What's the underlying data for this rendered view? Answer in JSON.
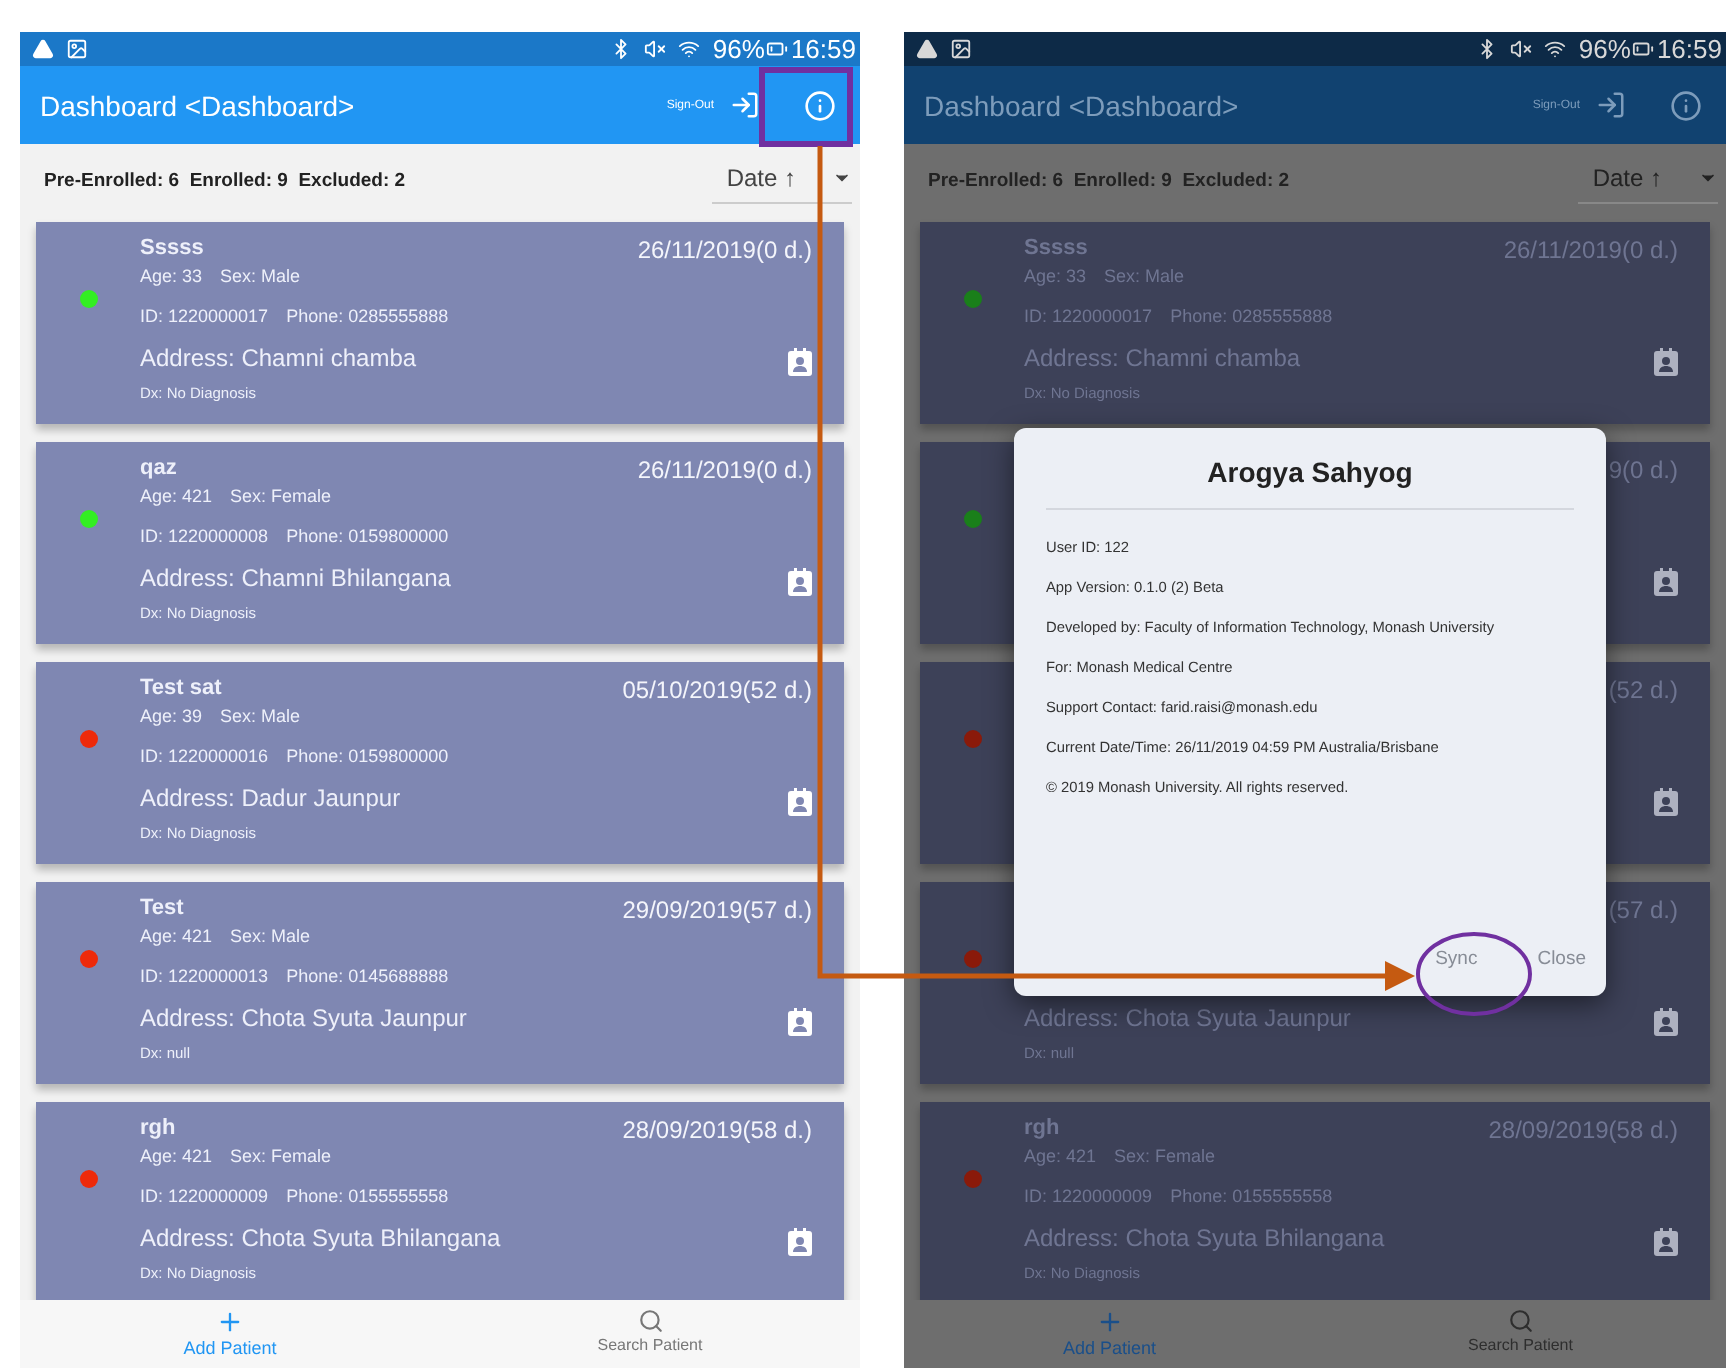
{
  "screens": [
    {
      "dimmed": false,
      "status_bar": {
        "battery": "96%",
        "time": "16:59"
      },
      "app_bar": {
        "title": "Dashboard <Dashboard>",
        "sign_out": "Sign-Out"
      },
      "summary": "Pre-Enrolled: 6  Enrolled: 9  Excluded: 2",
      "sort": {
        "label": "Date ↑"
      },
      "patients": [
        {
          "name": "Sssss",
          "age": "Age: 33",
          "sex": "Sex: Male",
          "id": "ID: 1220000017",
          "phone": "Phone: 0285555888",
          "address": "Address: Chamni chamba",
          "dx": "Dx: No Diagnosis",
          "date": "26/11/2019(0 d.)",
          "color": "#33ee22"
        },
        {
          "name": "qaz",
          "age": "Age: 421",
          "sex": "Sex: Female",
          "id": "ID: 1220000008",
          "phone": "Phone: 0159800000",
          "address": "Address: Chamni Bhilangana",
          "dx": "Dx: No Diagnosis",
          "date": "26/11/2019(0 d.)",
          "color": "#33ee22"
        },
        {
          "name": "Test sat",
          "age": "Age: 39",
          "sex": "Sex: Male",
          "id": "ID: 1220000016",
          "phone": "Phone: 0159800000",
          "address": "Address: Dadur Jaunpur",
          "dx": "Dx: No Diagnosis",
          "date": "05/10/2019(52 d.)",
          "color": "#ee2a0a"
        },
        {
          "name": "Test",
          "age": "Age: 421",
          "sex": "Sex: Male",
          "id": "ID: 1220000013",
          "phone": "Phone: 0145688888",
          "address": "Address: Chota Syuta Jaunpur",
          "dx": "Dx: null",
          "date": "29/09/2019(57 d.)",
          "color": "#ee2a0a"
        },
        {
          "name": "rgh",
          "age": "Age: 421",
          "sex": "Sex: Female",
          "id": "ID: 1220000009",
          "phone": "Phone: 0155555558",
          "address": "Address: Chota Syuta Bhilangana",
          "dx": "Dx: No Diagnosis",
          "date": "28/09/2019(58 d.)",
          "color": "#ee2a0a"
        }
      ],
      "bottom_nav": [
        {
          "label": "Add Patient",
          "selected": true
        },
        {
          "label": "Search Patient",
          "selected": false
        }
      ]
    },
    {
      "dimmed": true,
      "status_bar": {
        "battery": "96%",
        "time": "16:59"
      },
      "app_bar": {
        "title": "Dashboard <Dashboard>",
        "sign_out": "Sign-Out"
      },
      "summary": "Pre-Enrolled: 6  Enrolled: 9  Excluded: 2",
      "sort": {
        "label": "Date ↑"
      },
      "patients": [
        {
          "name": "Sssss",
          "age": "Age: 33",
          "sex": "Sex: Male",
          "id": "ID: 1220000017",
          "phone": "Phone: 0285555888",
          "address": "Address: Chamni chamba",
          "dx": "Dx: No Diagnosis",
          "date": "26/11/2019(0 d.)",
          "color": "#1a7f1a"
        },
        {
          "date": "9(0 d.)",
          "color": "#1a7f1a"
        },
        {
          "date": "(52 d.)",
          "color": "#8a1a0a"
        },
        {
          "address": "Address: Chota Syuta Jaunpur",
          "dx": "Dx: null",
          "date": "(57 d.)",
          "color": "#8a1a0a"
        },
        {
          "name": "rgh",
          "age": "Age: 421",
          "sex": "Sex: Female",
          "id": "ID: 1220000009",
          "phone": "Phone: 0155555558",
          "address": "Address: Chota Syuta Bhilangana",
          "dx": "Dx: No Diagnosis",
          "date": "28/09/2019(58 d.)",
          "color": "#8a1a0a"
        }
      ],
      "bottom_nav": [
        {
          "label": "Add Patient",
          "selected": true
        },
        {
          "label": "Search Patient",
          "selected": false
        }
      ],
      "dialog": {
        "title": "Arogya Sahyog",
        "lines": [
          "User ID: 122",
          "App Version: 0.1.0 (2) Beta",
          "Developed by: Faculty of Information Technology, Monash University",
          "For: Monash Medical Centre",
          "Support Contact: farid.raisi@monash.edu",
          "Current Date/Time: 26/11/2019 04:59 PM Australia/Brisbane",
          "© 2019 Monash University. All rights reserved."
        ],
        "buttons": [
          "Sync",
          "Close"
        ]
      }
    }
  ]
}
